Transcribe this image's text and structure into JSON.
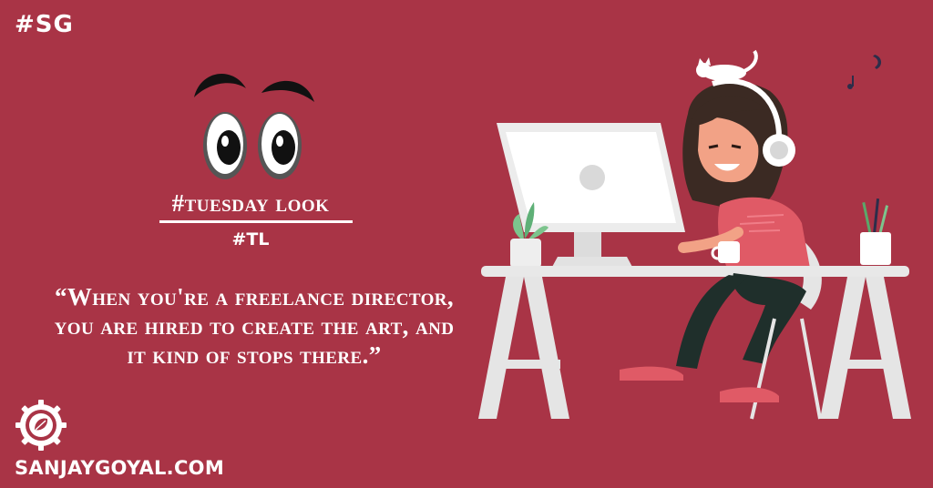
{
  "header": {
    "tag": "#SG"
  },
  "post": {
    "title": "#tuesday look",
    "subtag": "#TL",
    "quote": "“When you're a freelance director, you are hired to create the art, and it kind of  stops there.”"
  },
  "footer": {
    "website": "SANJAYGOYAL.COM"
  },
  "colors": {
    "background": "#a93446",
    "text": "#ffffff",
    "desk": "#e8e8e8",
    "hair": "#3b2a23",
    "shirt": "#e05a66",
    "pants": "#1f2f2b"
  },
  "icons": [
    "cartoon-eyes-icon",
    "gear-logo-icon",
    "cat-icon",
    "headphones-icon",
    "plant-icon",
    "pencil-cup-icon",
    "music-notes-icon"
  ]
}
